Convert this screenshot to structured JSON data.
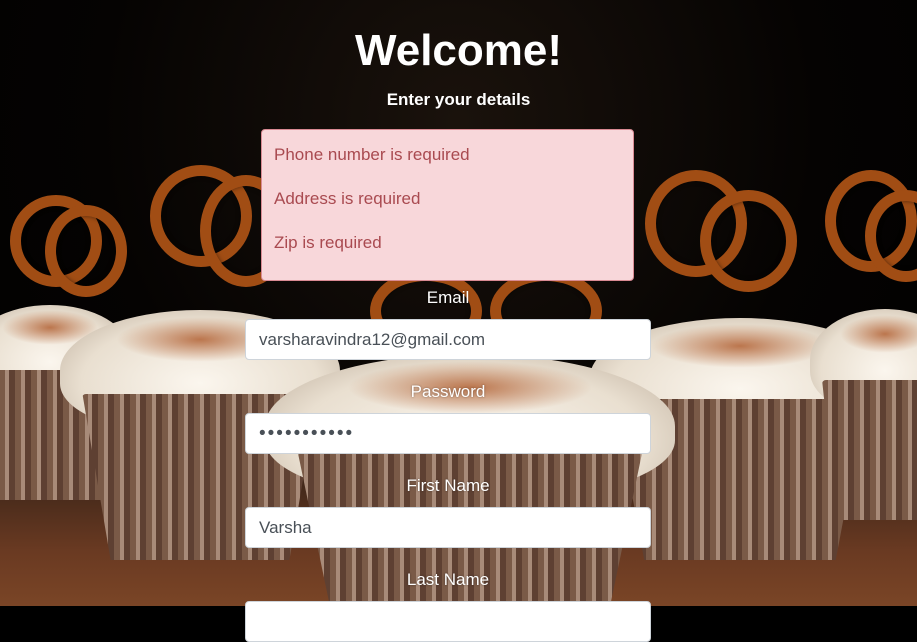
{
  "header": {
    "title": "Welcome!",
    "subtitle": "Enter your details"
  },
  "errors": [
    "Phone number is required",
    "Address is required",
    "Zip is required"
  ],
  "form": {
    "email": {
      "label": "Email",
      "value": "varsharavindra12@gmail.com"
    },
    "password": {
      "label": "Password",
      "value": "•••••••••••"
    },
    "first_name": {
      "label": "First Name",
      "value": "Varsha"
    },
    "last_name": {
      "label": "Last Name",
      "value": ""
    }
  },
  "colors": {
    "error_bg": "#f8d7da",
    "error_text": "#a94a50",
    "text": "#ffffff"
  }
}
